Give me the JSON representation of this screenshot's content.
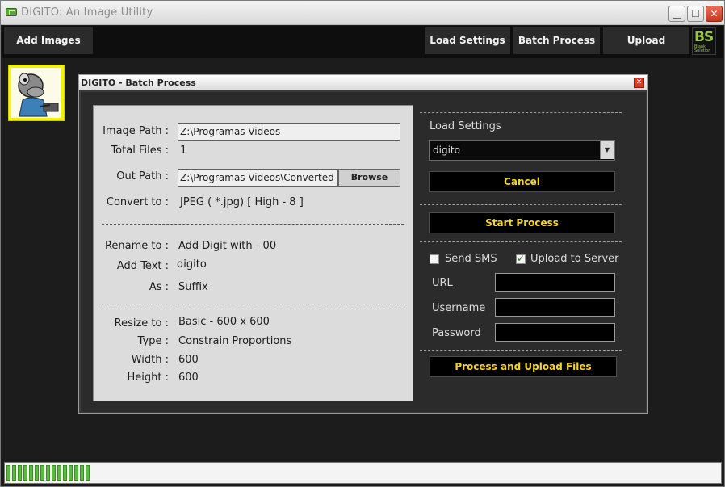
{
  "window": {
    "title": "DIGITO: An Image Utility"
  },
  "toolbar": {
    "add_images": "Add Images",
    "load_settings": "Load Settings",
    "batch_process": "Batch Process",
    "upload": "Upload",
    "logo_mark": "BS",
    "logo_sub": "Blank Solution"
  },
  "dialog": {
    "title": "DIGITO - Batch Process",
    "close_glyph": "✕",
    "left": {
      "image_path_label": "Image Path :",
      "image_path_value": "Z:\\Programas Videos",
      "total_files_label": "Total Files :",
      "total_files_value": "1",
      "out_path_label": "Out Path :",
      "out_path_value": "Z:\\Programas Videos\\Converted_I",
      "browse_label": "Browse",
      "convert_to_label": "Convert to :",
      "convert_to_value": "JPEG ( *.jpg) [ High - 8 ]",
      "rename_to_label": "Rename to :",
      "rename_to_value": "Add Digit with -  00",
      "add_text_label": "Add Text :",
      "add_text_value": "digito",
      "as_label": "As :",
      "as_value": "Suffix",
      "resize_to_label": "Resize to :",
      "resize_to_value": "Basic - 600 x 600",
      "type_label": "Type :",
      "type_value": "Constrain Proportions",
      "width_label": "Width :",
      "width_value": "600",
      "height_label": "Height :",
      "height_value": "600"
    },
    "right": {
      "load_settings_label": "Load Settings",
      "settings_selected": "digito",
      "cancel_label": "Cancel",
      "start_label": "Start Process",
      "send_sms_label": "Send SMS",
      "send_sms_checked": false,
      "upload_server_label": "Upload to Server",
      "upload_server_checked": true,
      "url_label": "URL",
      "username_label": "Username",
      "password_label": "Password",
      "url_value": "",
      "username_value": "",
      "password_value": "",
      "process_upload_label": "Process and Upload Files"
    }
  },
  "status": {
    "progress_segments": 15
  },
  "icons": {
    "app": "app-icon",
    "minimize": "minimize-icon",
    "maximize": "maximize-icon",
    "close": "close-icon",
    "dropdown": "chevron-down-icon",
    "check": "check-icon"
  },
  "colors": {
    "accent_text": "#f5d52a",
    "thumbnail_border": "#f4f400",
    "progress": "#5ab93f",
    "logo": "#9bc34f"
  }
}
